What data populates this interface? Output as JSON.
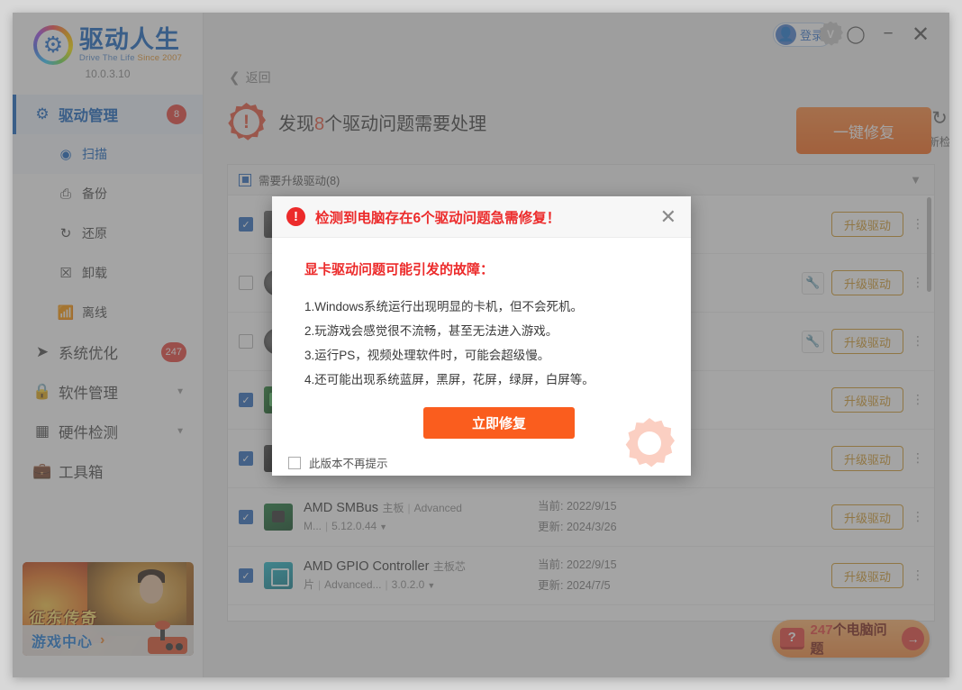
{
  "app": {
    "brand_cn": "驱动人生",
    "brand_en_main": "Drive The Life",
    "brand_en_since": "Since 2007",
    "version": "10.0.3.10"
  },
  "titlebar": {
    "login_label": "登录",
    "vip_badge": "V",
    "settings_icon": "gear-icon",
    "minimize_icon": "minimize-icon",
    "close_icon": "close-icon"
  },
  "sidebar": {
    "items": [
      {
        "label": "驱动管理",
        "icon": "gear-icon",
        "badge": "8",
        "active": true
      },
      {
        "label": "扫描",
        "icon": "scan-icon",
        "sub": true,
        "selected": true
      },
      {
        "label": "备份",
        "icon": "backup-icon",
        "sub": true
      },
      {
        "label": "还原",
        "icon": "restore-icon",
        "sub": true
      },
      {
        "label": "卸载",
        "icon": "uninstall-icon",
        "sub": true
      },
      {
        "label": "离线",
        "icon": "offline-icon",
        "sub": true
      },
      {
        "label": "系统优化",
        "icon": "rocket-icon",
        "badge": "247"
      },
      {
        "label": "软件管理",
        "icon": "lock-icon",
        "caret": true
      },
      {
        "label": "硬件检测",
        "icon": "cpu-icon",
        "caret": true
      },
      {
        "label": "工具箱",
        "icon": "toolbox-icon"
      }
    ],
    "promo": {
      "game_title": "征东传奇",
      "cta": "游戏中心",
      "arrow": "›"
    }
  },
  "content": {
    "back_label": "返回",
    "headline_prefix": "发现",
    "headline_count": "8",
    "headline_suffix": "个驱动问题需要处理",
    "redetect_label": "重新检测",
    "fix_all_label": "一键修复",
    "group_label": "需要升级驱动(8)",
    "bottom_pill": {
      "q_mark": "?",
      "count": "247",
      "text_suffix": "个电脑问题",
      "arrow": "→"
    },
    "columns": {
      "current_prefix": "当前:",
      "update_prefix": "更新:"
    },
    "rows": [
      {
        "checked": true,
        "icon": "gpu-icon",
        "icon_class": "ico-gpu",
        "name": "",
        "category": "",
        "vendor": "",
        "version": "",
        "current": "",
        "update": "",
        "has_wrench": false,
        "upgrade_label": "升级驱动",
        "kebab": "⋮"
      },
      {
        "checked": false,
        "icon": "audio-icon",
        "icon_class": "ico-audio",
        "name": "",
        "category": "",
        "vendor": "",
        "version": "",
        "current": "",
        "update": "",
        "has_wrench": true,
        "upgrade_label": "升级驱动",
        "kebab": "⋮"
      },
      {
        "checked": false,
        "icon": "audio-icon",
        "icon_class": "ico-audio",
        "name": "",
        "category": "",
        "vendor": "",
        "version": "",
        "current": "",
        "update": "",
        "has_wrench": true,
        "upgrade_label": "升级驱动",
        "kebab": "⋮"
      },
      {
        "checked": true,
        "icon": "network-icon",
        "icon_class": "ico-net",
        "name": "",
        "category": "",
        "vendor": "",
        "version": "",
        "current": "",
        "update": "",
        "has_wrench": false,
        "upgrade_label": "升级驱动",
        "kebab": "⋮"
      },
      {
        "checked": true,
        "icon": "disk-icon",
        "icon_class": "ico-disk",
        "name": "",
        "category": "",
        "vendor": "",
        "version": "",
        "current": "",
        "update": "",
        "has_wrench": false,
        "upgrade_label": "升级驱动",
        "kebab": "⋮"
      },
      {
        "checked": true,
        "icon": "motherboard-icon",
        "icon_class": "ico-board",
        "name": "AMD SMBus",
        "category": "主板",
        "vendor": "Advanced M...",
        "version": "5.12.0.44",
        "current": "当前: 2022/9/15",
        "update": "更新: 2024/3/26",
        "has_wrench": false,
        "upgrade_label": "升级驱动",
        "kebab": "⋮"
      },
      {
        "checked": true,
        "icon": "chipset-icon",
        "icon_class": "ico-chip",
        "name": "AMD GPIO Controller",
        "category": "主板芯片",
        "vendor": "Advanced...",
        "version": "3.0.2.0",
        "current": "当前: 2022/9/15",
        "update": "更新: 2024/7/5",
        "has_wrench": false,
        "upgrade_label": "升级驱动",
        "kebab": "⋮"
      }
    ]
  },
  "modal": {
    "title": "检测到电脑存在6个驱动问题急需修复！",
    "close_icon": "close-icon",
    "subtitle": "显卡驱动问题可能引发的故障：",
    "bullets": [
      "1.Windows系统运行出现明显的卡机，但不会死机。",
      "2.玩游戏会感觉很不流畅，甚至无法进入游戏。",
      "3.运行PS，视频处理软件时，可能会超级慢。",
      "4.还可能出现系统蓝屏，黑屏，花屏，绿屏，白屏等。"
    ],
    "cta_label": "立即修复",
    "remember_label": "此版本不再提示"
  },
  "colors": {
    "brand_blue": "#1565c0",
    "accent_orange": "#fa5d1e",
    "alert_red": "#ec2b2b",
    "upgrade_gold": "#d39a2b",
    "badge_red": "#e8443a"
  }
}
